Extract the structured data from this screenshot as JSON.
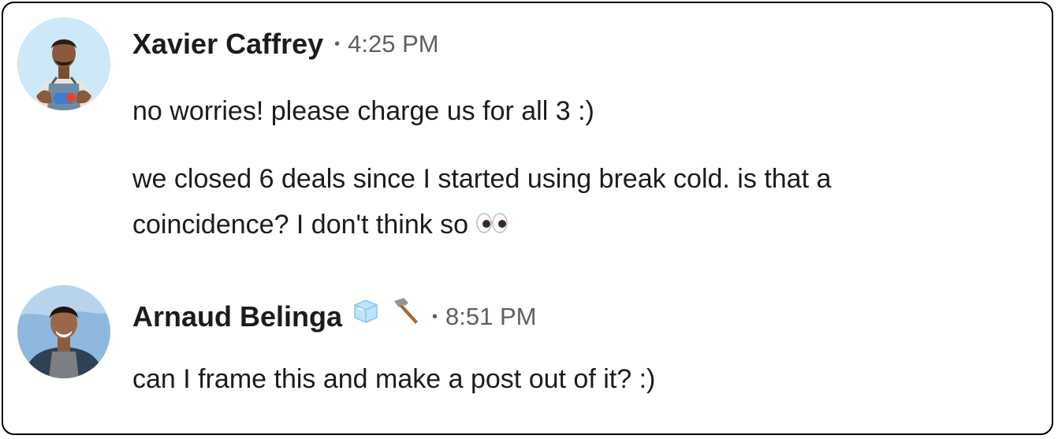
{
  "messages": [
    {
      "author": "Xavier Caffrey",
      "separator": "•",
      "time": "4:25 PM",
      "avatar_icon": "avatar-xavier",
      "lines": [
        "no worries! please charge us for all 3 :)",
        "we closed 6 deals since I started using break cold. is that a",
        "coincidence? I don't think so"
      ],
      "trailing_emoji": "eyes-emoji"
    },
    {
      "author": "Arnaud Belinga",
      "separator": "•",
      "time": "8:51 PM",
      "avatar_icon": "avatar-arnaud",
      "status_emojis": [
        "ice-cube-emoji",
        "hammer-emoji"
      ],
      "lines": [
        "can I frame this and make a post out of it? :)"
      ]
    }
  ],
  "colors": {
    "text": "#1d1c1d",
    "muted": "#616061",
    "border": "#000000",
    "background": "#ffffff"
  }
}
